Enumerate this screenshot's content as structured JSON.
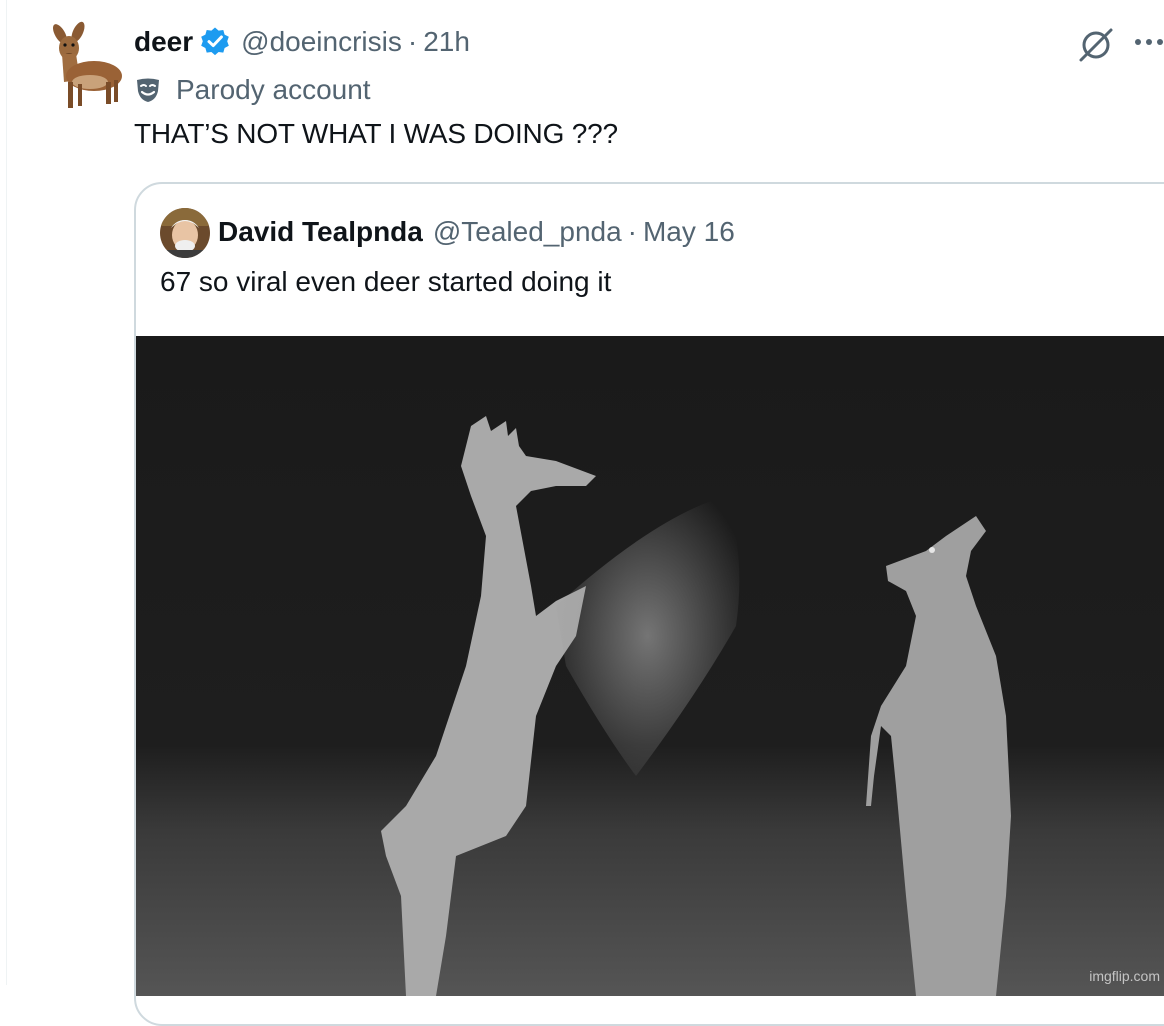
{
  "post": {
    "author_name": "deer",
    "author_handle": "@doeincrisis",
    "separator": "·",
    "time": "21h",
    "label": "Parody account",
    "text": "THAT’S NOT WHAT I WAS DOING ???",
    "icons": {
      "avatar": "deer-avatar",
      "verified": "verified-badge-icon",
      "grok": "grok-icon",
      "more": "more-icon",
      "parody": "parody-mask-icon"
    }
  },
  "quote": {
    "author_name": "David Tealpnda",
    "author_handle": "@Tealed_pnda",
    "separator": "·",
    "date": "May 16",
    "text": "67 so viral even deer started doing it",
    "media": {
      "description_icon": "trail-cam-image",
      "watermark": "imgflip.com"
    }
  },
  "colors": {
    "text_primary": "#0f1419",
    "text_secondary": "#536471",
    "verified_blue": "#1d9bf0",
    "border": "#cfd9de"
  }
}
